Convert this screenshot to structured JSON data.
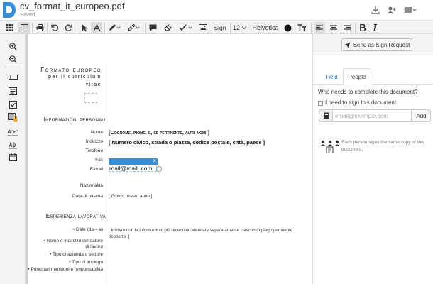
{
  "header": {
    "filename": "cv_format_it_europeo.pdf",
    "status": "Saved"
  },
  "toolbar": {
    "sign_label": "Sign",
    "font_size": "12",
    "font_name": "Helvetica"
  },
  "document": {
    "title_lines": [
      "Formato europeo",
      "per il curriculum",
      "vitae"
    ],
    "sections": {
      "personal": "Informazioni personali",
      "experience": "Esperienza lavorativa"
    },
    "labels": {
      "nome": "Nome",
      "indirizzo": "Indirizzo",
      "telefono": "Telefono",
      "fax": "Fax",
      "email": "E-mail",
      "nazionalita": "Nazionalità",
      "data_nascita": "Data di nascita",
      "date": "• Date (da – a)",
      "datore": "• Nome e indirizzo del datore di lavoro",
      "tipo_azienda": "• Tipo di azienda o settore",
      "tipo_impiego": "• Tipo di impiego",
      "mansioni": "• Principali mansioni e responsabilità"
    },
    "values": {
      "nome": "[Cognome, Nome, e, se pertinente, altri nomi ]",
      "indirizzo": "[ Numero civico, strada o piazza, codice postale, città, paese ]",
      "data_nascita": "[ Giorno, mese, anno ]",
      "esperienza": "[ Iniziare con le informazioni più recenti ed elencare separatamente ciascun impiego pertinente ricoperto. ]"
    },
    "email_field": {
      "value": "mail@mail..com",
      "close": "×"
    }
  },
  "panel": {
    "send_button": "Send as Sign Request",
    "tabs": [
      "Field",
      "People"
    ],
    "question": "Who needs to complete this document?",
    "checkbox_label": "I need to sign this document",
    "email_placeholder": "email@example.com",
    "add_button": "Add",
    "note": "Each person signs the same copy of this document."
  },
  "colors": {
    "brand": "#3a8ed8",
    "toolbar_bg": "#f3f3f3",
    "field_bar": "#3a8ed8"
  },
  "icons": {
    "header": [
      "download-icon",
      "add-user-icon",
      "menu-icon"
    ],
    "toolbar": [
      "grid-icon",
      "sidebar-icon",
      "print-icon",
      "undo-icon",
      "redo-icon",
      "pointer-icon",
      "text-icon",
      "pen-icon",
      "highlighter-icon",
      "comment-icon",
      "eraser-icon",
      "checkmark-icon",
      "image-icon",
      "color-circle-icon",
      "text-size-icon",
      "align-left-icon",
      "align-center-icon",
      "align-right-icon",
      "bold-icon",
      "italic-icon"
    ],
    "rail": [
      "zoom-in-icon",
      "zoom-out-icon",
      "textfield-icon",
      "textarea-icon",
      "checkbox-icon",
      "locked-field-icon",
      "signature-icon",
      "initials-icon",
      "date-icon"
    ]
  }
}
